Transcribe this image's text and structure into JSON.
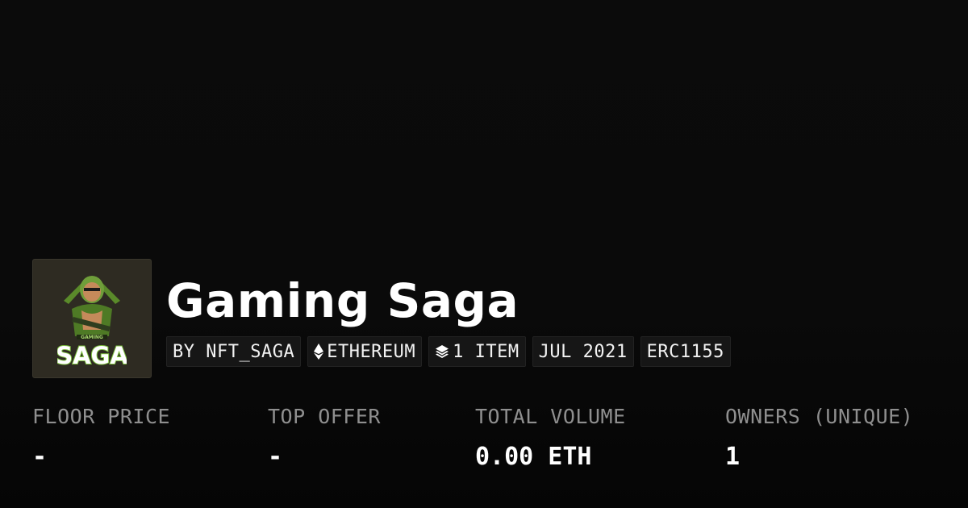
{
  "collection": {
    "title": "Gaming Saga",
    "logo_text": "SAGA",
    "logo_subtext": "GAMING"
  },
  "chips": [
    {
      "label": "BY NFT_SAGA",
      "icon": null
    },
    {
      "label": "ETHEREUM",
      "icon": "ethereum-icon"
    },
    {
      "label": "1 ITEM",
      "icon": "layers-icon"
    },
    {
      "label": "JUL 2021",
      "icon": null
    },
    {
      "label": "ERC1155",
      "icon": null
    }
  ],
  "stats": [
    {
      "label": "FLOOR PRICE",
      "value": "-"
    },
    {
      "label": "TOP OFFER",
      "value": "-"
    },
    {
      "label": "TOTAL VOLUME",
      "value": "0.00 ETH"
    },
    {
      "label": "OWNERS (UNIQUE)",
      "value": "1"
    }
  ],
  "colors": {
    "background": "#0a0a0a",
    "avatar_bg": "#2e2b22",
    "chip_bg": "#161616",
    "label_gray": "#8f8f8f",
    "logo_green": "#7fc241"
  }
}
